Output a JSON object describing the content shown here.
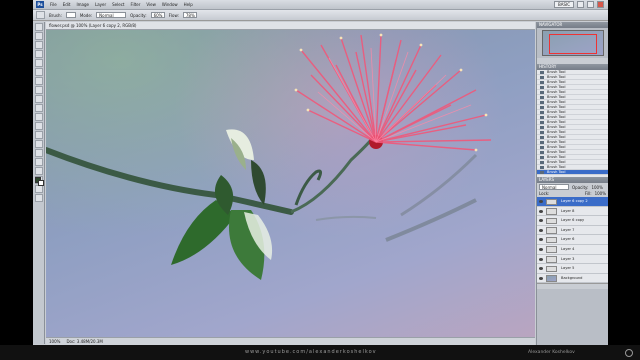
{
  "menubar": {
    "app_logo": "Ps",
    "items": [
      "File",
      "Edit",
      "Image",
      "Layer",
      "Select",
      "Filter",
      "View",
      "Window",
      "Help"
    ],
    "workspace": "BASIC"
  },
  "options": {
    "brush_label": "Brush:",
    "mode_label": "Mode:",
    "mode_value": "Normal",
    "opacity_label": "Opacity:",
    "opacity_value": "60%",
    "flow_label": "Flow:",
    "flow_value": "78%"
  },
  "document": {
    "tab_title": "flower.psd @ 100% (Layer 6 copy 2, RGB/8)"
  },
  "statusbar": {
    "zoom": "100%",
    "doc_info": "Doc: 3.48M/20.3M"
  },
  "navigator": {
    "title": "NAVIGATOR"
  },
  "history": {
    "title": "HISTORY",
    "items": [
      "Brush Tool",
      "Brush Tool",
      "Brush Tool",
      "Brush Tool",
      "Brush Tool",
      "Brush Tool",
      "Brush Tool",
      "Brush Tool",
      "Brush Tool",
      "Brush Tool",
      "Brush Tool",
      "Brush Tool",
      "Brush Tool",
      "Brush Tool",
      "Brush Tool",
      "Brush Tool",
      "Brush Tool",
      "Brush Tool",
      "Brush Tool",
      "Brush Tool",
      "Brush Tool"
    ]
  },
  "layers": {
    "title": "LAYERS",
    "blend_mode": "Normal",
    "opacity_label": "Opacity:",
    "opacity_value": "100%",
    "lock_label": "Lock:",
    "fill_label": "Fill:",
    "fill_value": "100%",
    "items": [
      "Layer 6 copy 2",
      "Layer 8",
      "Layer 6 copy",
      "Layer 7",
      "Layer 6",
      "Layer 4",
      "Layer 3",
      "Layer 5",
      "Background"
    ]
  },
  "footer": {
    "url": "www.youtube.com/alexanderkoshelkov",
    "credit": "Alexander Koshelkov"
  },
  "colors": {
    "accent": "#3a6cc8",
    "flower": "#e8506e",
    "leaf": "#2f5a2f"
  }
}
